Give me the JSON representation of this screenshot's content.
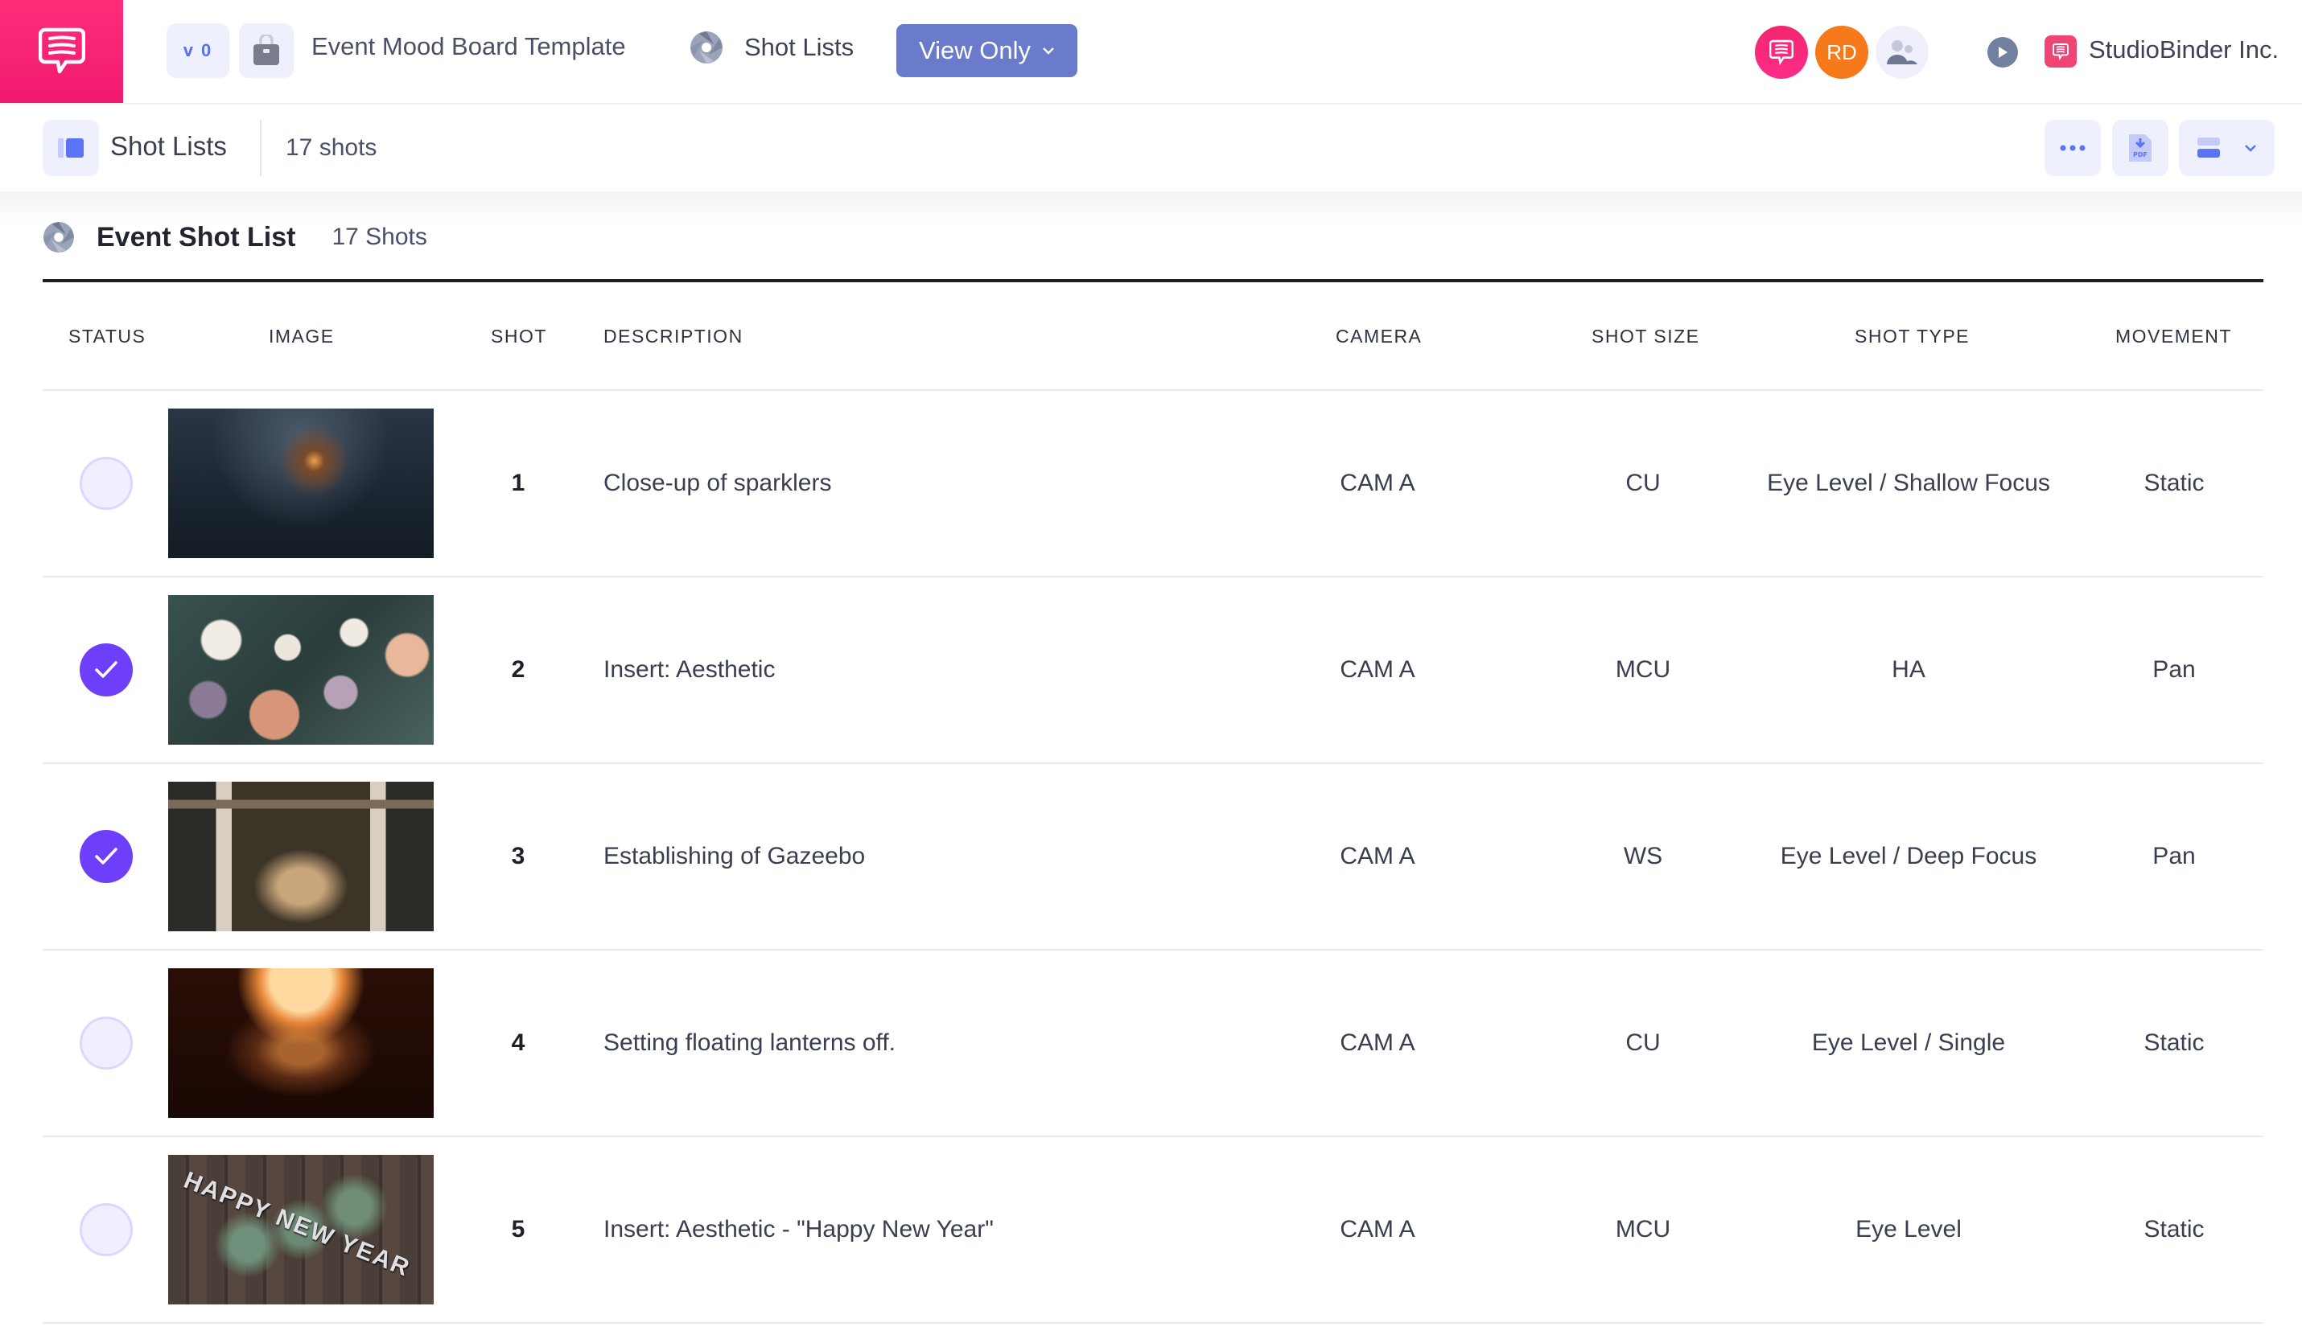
{
  "topbar": {
    "logo_icon": "chat-bubble-icon",
    "version_label": "v 0",
    "lock_icon": "lock-bag-icon",
    "project_title": "Event Mood Board Template",
    "nav_shotlists_icon": "aperture-icon",
    "nav_shotlists_label": "Shot Lists",
    "view_mode_button": "View Only",
    "avatars": [
      {
        "type": "icon",
        "icon": "chat-bubble-icon",
        "color": "#f2266e"
      },
      {
        "type": "initials",
        "label": "RD",
        "color": "#f77a1a"
      },
      {
        "type": "icon",
        "icon": "people-icon",
        "color": "#eff0fb"
      }
    ],
    "play_icon": "play-icon",
    "org_name": "StudioBinder Inc."
  },
  "subbar": {
    "section_icon": "shotlist-icon",
    "section_label": "Shot Lists",
    "shot_count": "17 shots",
    "actions": [
      "more-icon",
      "pdf-export-icon",
      "view-layout-icon"
    ]
  },
  "shotlist": {
    "title": "Event Shot List",
    "count": "17 Shots",
    "columns": [
      "STATUS",
      "IMAGE",
      "SHOT",
      "DESCRIPTION",
      "CAMERA",
      "SHOT SIZE",
      "SHOT TYPE",
      "MOVEMENT"
    ],
    "rows": [
      {
        "done": false,
        "image": "sparklers",
        "shot": "1",
        "description": "Close-up of sparklers",
        "camera": "CAM A",
        "size": "CU",
        "type": "Eye Level / Shallow Focus",
        "movement": "Static"
      },
      {
        "done": true,
        "image": "flowers",
        "shot": "2",
        "description": "Insert: Aesthetic",
        "camera": "CAM A",
        "size": "MCU",
        "type": "HA",
        "movement": "Pan"
      },
      {
        "done": true,
        "image": "gazebo",
        "shot": "3",
        "description": "Establishing of Gazeebo",
        "camera": "CAM A",
        "size": "WS",
        "type": "Eye Level / Deep Focus",
        "movement": "Pan"
      },
      {
        "done": false,
        "image": "lantern",
        "shot": "4",
        "description": "Setting floating lanterns off.",
        "camera": "CAM A",
        "size": "CU",
        "type": "Eye Level / Single",
        "movement": "Static"
      },
      {
        "done": false,
        "image": "happy-new-year",
        "shot": "5",
        "description": "Insert: Aesthetic - \"Happy New Year\"",
        "camera": "CAM A",
        "size": "MCU",
        "type": "Eye Level",
        "movement": "Static",
        "image_text": "HAPPY NEW YEAR"
      }
    ]
  },
  "colors": {
    "brand": "#f01a6e",
    "accent": "#6a7bcc",
    "check_on": "#6d3ffb",
    "check_off": "#f1efff"
  }
}
